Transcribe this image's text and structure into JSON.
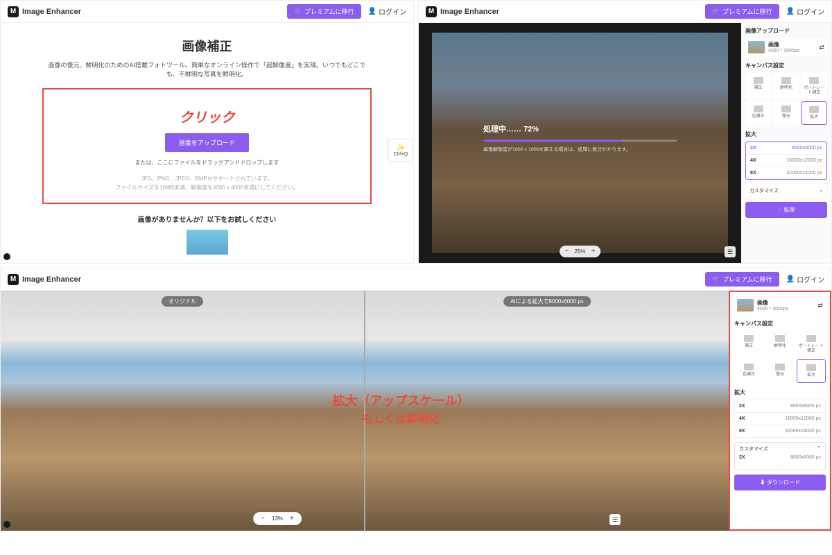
{
  "app": {
    "name": "Image Enhancer",
    "logo_letter": "M"
  },
  "header": {
    "premium": "プレミアムに移行",
    "login": "ログイン"
  },
  "p1": {
    "title": "画像補正",
    "subtitle": "画像の復元、鮮明化のためのAI搭載フォトツール。簡単なオンライン操作で「超解像度」を実現。いつでもどこでも、不鮮明な写真を鮮明化。",
    "click": "クリック",
    "upload_btn": "画像をアップロード",
    "drag_hint": "または、ここにファイルをドラッグアンドドロップします",
    "formats": "JPG、PNG、JPEG、BMPがサポートされています。",
    "size_limit": "ファイルサイズを10MB未満、解像度を4000 x 4000未満にしてください。",
    "try": "画像がありませんか？以下をお試しください",
    "side_tab": "Ctrl+Q"
  },
  "p2": {
    "upload_h": "画像アップロード",
    "img_name": "画像",
    "img_dim": "4000 * 3000px",
    "canvas_h": "キャンバス設定",
    "tools": [
      {
        "label": "補正"
      },
      {
        "label": "鮮明化"
      },
      {
        "label": "ポートレート補正"
      },
      {
        "label": "色補正"
      },
      {
        "label": "復元"
      },
      {
        "label": "拡大",
        "active": true
      }
    ],
    "scale_h": "拡大",
    "scales": [
      {
        "x": "2X",
        "dim": "8000x6000 px",
        "sel": true
      },
      {
        "x": "4X",
        "dim": "16000x12000 px"
      },
      {
        "x": "8X",
        "dim": "32000x24000 px"
      }
    ],
    "customize": "カスタマイズ",
    "process": "処理",
    "progress_label": "処理中……",
    "progress_pct": "72%",
    "progress_note": "画像解像度が1000 x 1000を超える場合は、処理に数分かかります。",
    "zoom": "25%"
  },
  "p3": {
    "tag_orig": "オリジナル",
    "tag_ai": "AIによる拡大で8000x6000 px",
    "annot1": "拡大（アップスケール）",
    "annot2": "もしくは鮮明化",
    "img_name": "画像",
    "img_dim": "4000 * 3000px",
    "canvas_h": "キャンバス設定",
    "tools": [
      {
        "label": "補正"
      },
      {
        "label": "鮮明化"
      },
      {
        "label": "ポートレート補正"
      },
      {
        "label": "色補正"
      },
      {
        "label": "復元"
      },
      {
        "label": "拡大",
        "active": true
      }
    ],
    "scale_h": "拡大",
    "scales": [
      {
        "x": "2X",
        "dim": "8000x6000 px"
      },
      {
        "x": "4X",
        "dim": "16000x12000 px"
      },
      {
        "x": "8X",
        "dim": "32000x24000 px"
      }
    ],
    "customize": "カスタマイズ",
    "custom_x": "2X",
    "custom_dim": "8000x6000 px",
    "custom_note": " ",
    "download": "ダウンロード",
    "zoom": "13%"
  }
}
